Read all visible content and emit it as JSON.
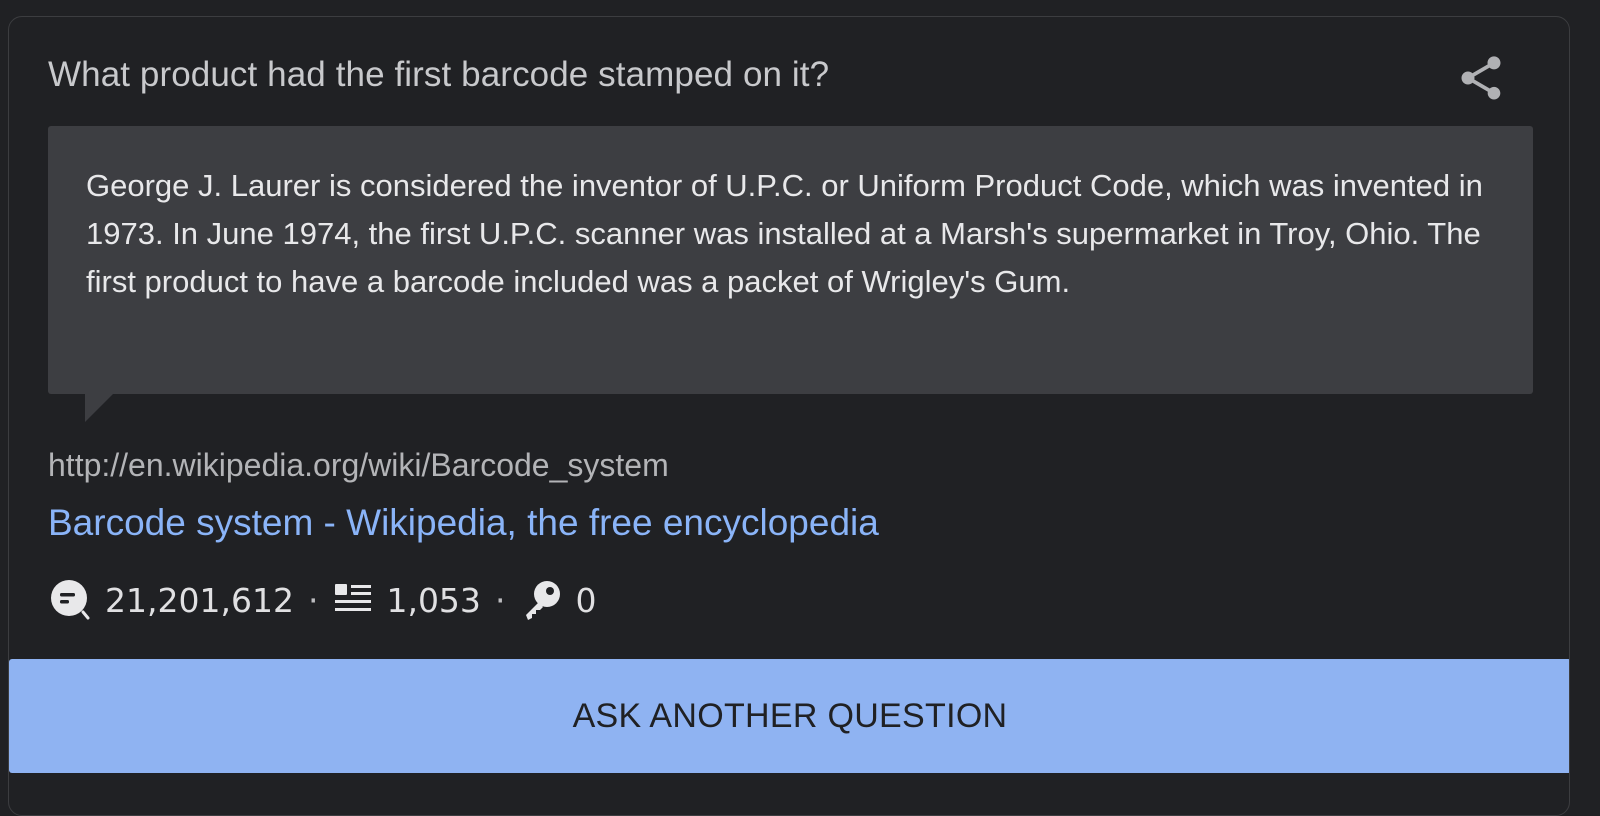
{
  "card": {
    "question": "What product had the first barcode stamped on it?",
    "share_icon": "share-icon",
    "answer": "George J. Laurer is considered the inventor of U.P.C. or Uniform Product Code, which was invented in 1973. In June 1974, the first U.P.C. scanner was installed at a Marsh's supermarket in Troy, Ohio. The first product to have a barcode included was a packet of Wrigley's Gum.",
    "source": {
      "url": "http://en.wikipedia.org/wiki/Barcode_system",
      "title": "Barcode system - Wikipedia, the free encyclopedia"
    },
    "stats": {
      "questions": {
        "icon": "question-bubble-icon",
        "value": "21,201,612"
      },
      "articles": {
        "icon": "article-list-icon",
        "value": "1,053"
      },
      "answers": {
        "icon": "key-icon",
        "value": "0"
      },
      "separator": "·"
    },
    "ask_button_label": "ASK ANOTHER QUESTION"
  },
  "colors": {
    "background": "#202124",
    "answer_box": "#3d3e42",
    "link": "#8ab4f8",
    "button": "#8fb3f2"
  }
}
